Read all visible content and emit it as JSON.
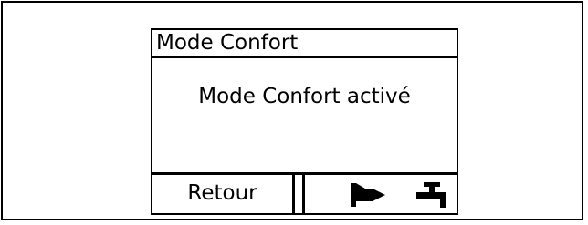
{
  "display": {
    "title": "Mode Confort",
    "message": "Mode Confort activé",
    "left_softkey_label": "Retour",
    "right_softkey_icons": [
      "burner-flame-icon",
      "hot-water-tap-icon"
    ]
  }
}
